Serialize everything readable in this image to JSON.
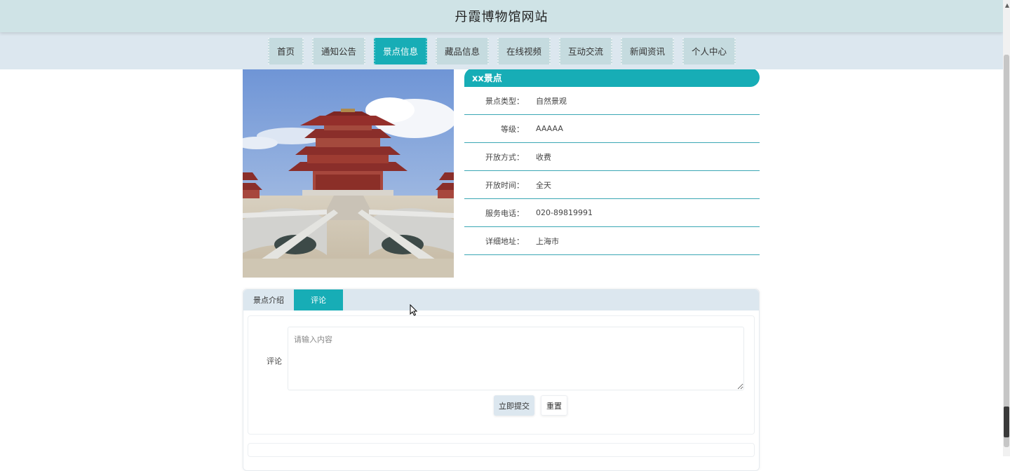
{
  "site": {
    "title": "丹霞博物馆网站"
  },
  "nav": {
    "items": [
      {
        "label": "首页"
      },
      {
        "label": "通知公告"
      },
      {
        "label": "景点信息"
      },
      {
        "label": "藏品信息"
      },
      {
        "label": "在线视频"
      },
      {
        "label": "互动交流"
      },
      {
        "label": "新闻资讯"
      },
      {
        "label": "个人中心"
      }
    ],
    "active_index": 2
  },
  "spot": {
    "name": "xx景点",
    "fields": [
      {
        "label": "景点类型：",
        "value": "自然景观"
      },
      {
        "label": "等级：",
        "value": "AAAAA"
      },
      {
        "label": "开放方式：",
        "value": "收费"
      },
      {
        "label": "开放时间：",
        "value": "全天"
      },
      {
        "label": "服务电话：",
        "value": "020-89819991"
      },
      {
        "label": "详细地址：",
        "value": "上海市"
      }
    ]
  },
  "tabs": {
    "items": [
      {
        "label": "景点介绍"
      },
      {
        "label": "评论"
      }
    ],
    "active_index": 1
  },
  "comment": {
    "label": "评论",
    "placeholder": "请输入内容",
    "submit_label": "立即提交",
    "reset_label": "重置"
  },
  "colors": {
    "accent": "#17adb6",
    "topbar": "#cfe3e6",
    "navbar": "#dce7ef",
    "nav_item": "#c5dbdf",
    "divider": "#3ba7b4"
  }
}
